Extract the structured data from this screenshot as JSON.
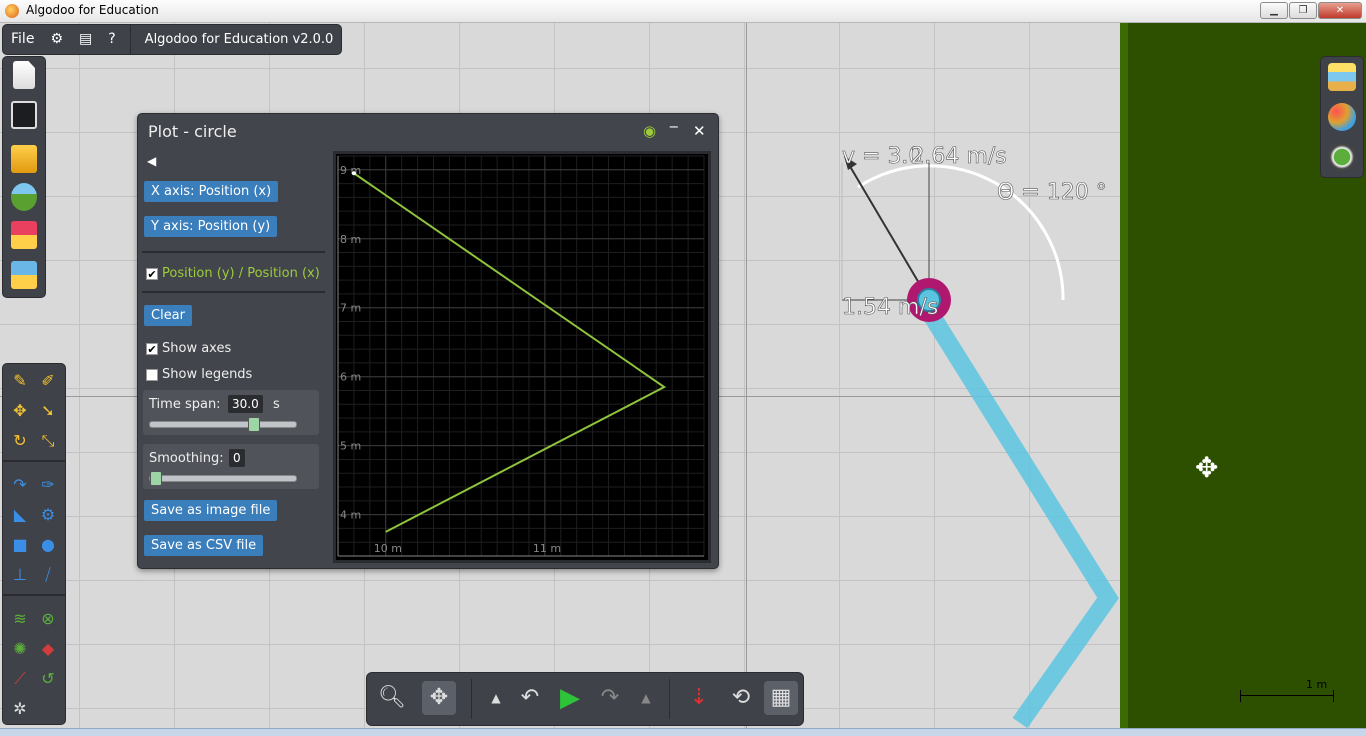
{
  "window": {
    "title": "Algodoo for Education",
    "minimize_glyph": "▁",
    "restore_glyph": "❐",
    "close_glyph": "✕"
  },
  "menubar": {
    "file": "File",
    "settings_icon": "⚙",
    "window_icon": "▤",
    "help": "?",
    "app_title": "Algodoo for Education v2.0.0"
  },
  "scene": {
    "velocity_label": "v = 3.0",
    "velocity_label_overlap": "2.64 m/s",
    "velocity_label_tail": "m/s",
    "angle_label": "Θ = 120 °",
    "speed_label": "1.54 m/s",
    "scale_label": "1 m",
    "move_cursor": "✥"
  },
  "plot": {
    "title": "Plot - circle",
    "back_icon": "◀",
    "x_axis_button": "X axis: Position (x)",
    "y_axis_button": "Y axis: Position (y)",
    "series_label": "Position (y) / Position (x)",
    "series_checked": true,
    "clear_button": "Clear",
    "show_axes_label": "Show axes",
    "show_axes_checked": true,
    "show_legends_label": "Show legends",
    "show_legends_checked": false,
    "time_span_label": "Time span:",
    "time_span_value": "30.0",
    "time_span_unit": "s",
    "time_span_slider_fraction": 0.73,
    "smoothing_label": "Smoothing:",
    "smoothing_value": "0",
    "smoothing_slider_fraction": 0.0,
    "save_image_button": "Save as image file",
    "save_csv_button": "Save as CSV file",
    "check_glyph": "✔",
    "minimize_glyph": "‒",
    "close_glyph": "✕",
    "eye_glyph": "◉"
  },
  "chart_data": {
    "type": "line",
    "title": "",
    "xlabel": "",
    "ylabel": "",
    "x_ticks": [
      "10 m",
      "11 m"
    ],
    "y_ticks": [
      "9 m",
      "8 m",
      "7 m",
      "6 m",
      "5 m",
      "4 m"
    ],
    "xlim": [
      9.7,
      12.0
    ],
    "ylim": [
      3.4,
      9.2
    ],
    "grid": true,
    "series": [
      {
        "name": "Position (y) / Position (x)",
        "color": "#8fc43c",
        "x": [
          9.8,
          11.75,
          10.0
        ],
        "y": [
          8.95,
          5.85,
          3.75
        ]
      }
    ]
  },
  "colors": {
    "panel": "#42454b",
    "button": "#3a7ebc",
    "ground": "#2c5000",
    "plot_line": "#8fc43c",
    "trail": "#5bc4e0",
    "ball_ring": "#b0176e"
  }
}
